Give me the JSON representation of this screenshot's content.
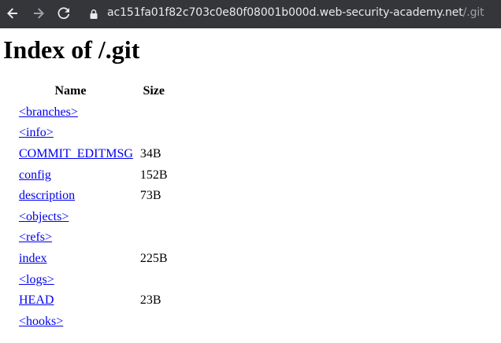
{
  "browser": {
    "url_host": "ac151fa01f82c703c0e80f08001b000d.web-security-academy.net",
    "url_path": "/.git"
  },
  "page": {
    "title": "Index of /.git",
    "columns": {
      "name": "Name",
      "size": "Size"
    },
    "entries": [
      {
        "name": "<branches>",
        "size": ""
      },
      {
        "name": "<info>",
        "size": ""
      },
      {
        "name": "COMMIT_EDITMSG",
        "size": "34B"
      },
      {
        "name": "config",
        "size": "152B"
      },
      {
        "name": "description",
        "size": "73B"
      },
      {
        "name": "<objects>",
        "size": ""
      },
      {
        "name": "<refs>",
        "size": ""
      },
      {
        "name": "index",
        "size": "225B"
      },
      {
        "name": "<logs>",
        "size": ""
      },
      {
        "name": "HEAD",
        "size": "23B"
      },
      {
        "name": "<hooks>",
        "size": ""
      }
    ]
  },
  "colors": {
    "toolbar_bg": "#35363a",
    "link": "#0000ee"
  },
  "icons": [
    "back-arrow-icon",
    "forward-arrow-icon",
    "reload-icon",
    "lock-icon"
  ]
}
